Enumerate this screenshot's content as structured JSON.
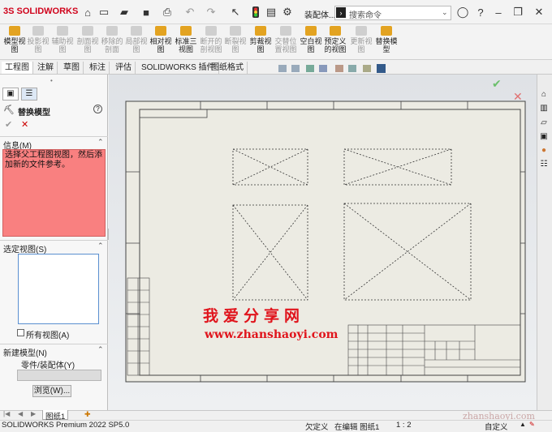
{
  "app": {
    "brand": "SOLIDWORKS",
    "doc_title": "装配体...",
    "search_placeholder": "搜索命令"
  },
  "commands": [
    {
      "label": "模型视\n图",
      "enabled": true
    },
    {
      "label": "投影视\n图",
      "enabled": false
    },
    {
      "label": "辅助视\n图",
      "enabled": false
    },
    {
      "label": "剖面视\n图",
      "enabled": false
    },
    {
      "label": "移除的\n剖面",
      "enabled": false
    },
    {
      "label": "局部视\n图",
      "enabled": false
    },
    {
      "label": "相对视\n图",
      "enabled": true
    },
    {
      "label": "标准三\n视图",
      "enabled": true
    },
    {
      "label": "断开的\n剖视图",
      "enabled": false
    },
    {
      "label": "断裂视\n图",
      "enabled": false
    },
    {
      "label": "剪裁视\n图",
      "enabled": true
    },
    {
      "label": "交替位\n置视图",
      "enabled": false
    },
    {
      "label": "空白视\n图",
      "enabled": true
    },
    {
      "label": "预定义\n的视图",
      "enabled": true
    },
    {
      "label": "更新视\n图",
      "enabled": false
    },
    {
      "label": "替换模\n型",
      "enabled": true
    }
  ],
  "tabs": [
    "工程图",
    "注解",
    "草图",
    "标注",
    "评估",
    "SOLIDWORKS 插件",
    "图纸格式"
  ],
  "panel": {
    "title": "替换模型",
    "help": "?",
    "ok": "✔",
    "cancel": "✕",
    "info_header": "信息(M)",
    "info_text": "选择父工程图视图，然后添加新的文件参考。",
    "selected_views_header": "选定视图(S)",
    "all_views_label": "所有视图(A)",
    "new_model_header": "新建模型(N)",
    "part_assembly_label": "零件/装配体(Y)",
    "browse_label": "浏览(W)..."
  },
  "sheet_tab": "图纸1",
  "status": {
    "product": "SOLIDWORKS Premium 2022 SP5.0",
    "undefined": "欠定义",
    "editing": "在编辑 图纸1",
    "scale": "1 : 2",
    "custom": "自定义"
  },
  "watermark": {
    "chinese": "我爱分享网",
    "url": "www.zhanshaoyi.com",
    "corner": "zhanshaoyi.com"
  },
  "colors": {
    "info_bg": "#f98080",
    "watermark": "#e0141c",
    "brand_red": "#d0021b"
  }
}
